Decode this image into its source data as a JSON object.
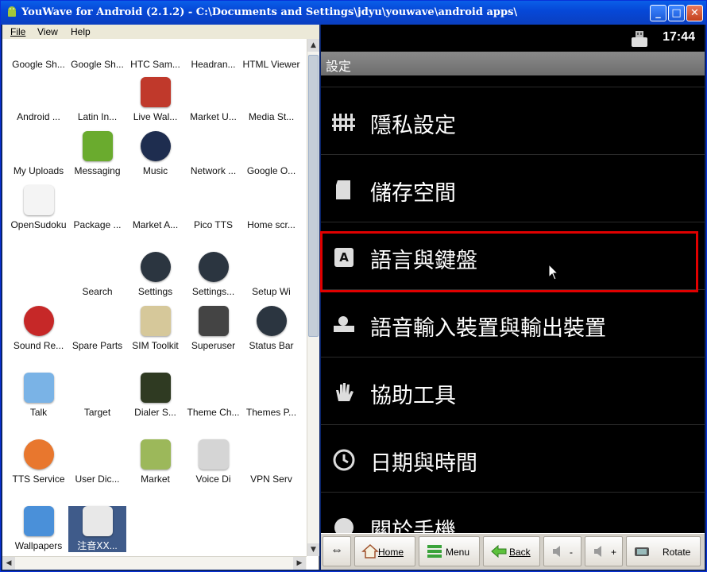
{
  "window": {
    "title": "YouWave for Android (2.1.2) - C:\\Documents and Settings\\jdyu\\youwave\\android apps\\",
    "buttons": {
      "minimize": "_",
      "maximize": "□",
      "close": "✕"
    }
  },
  "menubar": {
    "file": "File",
    "view": "View",
    "help": "Help"
  },
  "apps": [
    {
      "label": "Google Sh...",
      "icon": "google-icon"
    },
    {
      "label": "Google Sh...",
      "icon": "google-icon"
    },
    {
      "label": "HTC Sam...",
      "icon": "app-icon"
    },
    {
      "label": "Headran...",
      "icon": "app-icon"
    },
    {
      "label": "HTML Viewer",
      "icon": "html-icon"
    },
    {
      "label": "Android ...",
      "icon": "android-icon"
    },
    {
      "label": "Latin In...",
      "icon": "keyboard-icon"
    },
    {
      "label": "Live Wal...",
      "icon": "live-wallpaper-icon"
    },
    {
      "label": "Market U...",
      "icon": "market-icon"
    },
    {
      "label": "Media St...",
      "icon": "media-icon"
    },
    {
      "label": "My Uploads",
      "icon": "upload-icon"
    },
    {
      "label": "Messaging",
      "icon": "messaging-icon"
    },
    {
      "label": "Music",
      "icon": "music-icon"
    },
    {
      "label": "Network ...",
      "icon": "network-icon"
    },
    {
      "label": "Google O...",
      "icon": "google-icon"
    },
    {
      "label": "OpenSudoku",
      "icon": "sudoku-icon"
    },
    {
      "label": "Package ...",
      "icon": "package-icon"
    },
    {
      "label": "Market A...",
      "icon": "market-icon"
    },
    {
      "label": "Pico TTS",
      "icon": "tts-icon"
    },
    {
      "label": "Home scr...",
      "icon": "android-icon"
    },
    {
      "label": "",
      "icon": "blank-icon"
    },
    {
      "label": "Search",
      "icon": "search-icon"
    },
    {
      "label": "Settings",
      "icon": "settings-icon"
    },
    {
      "label": "Settings...",
      "icon": "settings-icon"
    },
    {
      "label": "Setup Wi",
      "icon": "setup-icon"
    },
    {
      "label": "Sound Re...",
      "icon": "microphone-icon"
    },
    {
      "label": "Spare Parts",
      "icon": "spare-parts-icon"
    },
    {
      "label": "SIM Toolkit",
      "icon": "sim-icon"
    },
    {
      "label": "Superuser",
      "icon": "superuser-icon"
    },
    {
      "label": "Status Bar",
      "icon": "settings-icon"
    },
    {
      "label": "Talk",
      "icon": "talk-icon"
    },
    {
      "label": "Target",
      "icon": "target-icon"
    },
    {
      "label": "Dialer S...",
      "icon": "dialer-icon"
    },
    {
      "label": "Theme Ch...",
      "icon": "theme-icon"
    },
    {
      "label": "Themes P...",
      "icon": "themes-icon"
    },
    {
      "label": "TTS Service",
      "icon": "tts-service-icon"
    },
    {
      "label": "User Dic...",
      "icon": "dictionary-icon"
    },
    {
      "label": "Market",
      "icon": "market-bag-icon"
    },
    {
      "label": "Voice Di",
      "icon": "voice-dialer-icon"
    },
    {
      "label": "VPN Serv",
      "icon": "vpn-icon"
    },
    {
      "label": "Wallpapers",
      "icon": "wallpaper-icon"
    },
    {
      "label": "注音ⅩⅩ...",
      "icon": "zhuyin-icon"
    }
  ],
  "android": {
    "time": "17:44",
    "settings_title": "設定",
    "items": [
      {
        "label": "隱私設定",
        "icon": "privacy-icon"
      },
      {
        "label": "儲存空間",
        "icon": "storage-icon"
      },
      {
        "label": "語言與鍵盤",
        "icon": "language-keyboard-icon"
      },
      {
        "label": "語音輸入裝置與輸出裝置",
        "icon": "voice-io-icon"
      },
      {
        "label": "協助工具",
        "icon": "accessibility-icon"
      },
      {
        "label": "日期與時間",
        "icon": "clock-icon"
      },
      {
        "label": "關於手機",
        "icon": "info-icon"
      }
    ]
  },
  "bottombar": {
    "rotate_arrow": "⇔",
    "home": "Home",
    "menu": "Menu",
    "back": "Back",
    "vol_down": "-",
    "vol_up": "+",
    "rotate": "Rotate"
  }
}
